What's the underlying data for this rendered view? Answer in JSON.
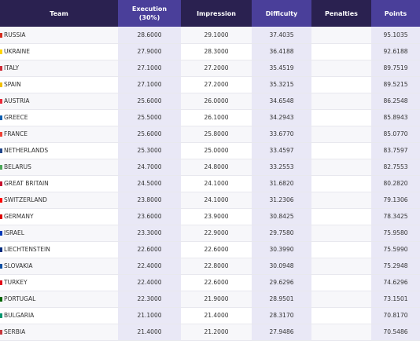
{
  "table": {
    "headers": {
      "team": "Team",
      "execution": "Execution\n(30%)",
      "impression": "Impression",
      "difficulty": "Difficulty",
      "penalties": "Penalties",
      "points": "Points"
    },
    "rows": [
      {
        "team": "RUSSIA",
        "flag_color": "#d52b1e",
        "execution": "28.6000",
        "impression": "29.1000",
        "difficulty": "37.4035",
        "penalties": "",
        "points": "95.1035"
      },
      {
        "team": "UKRAINE",
        "flag_color": "#ffd500",
        "execution": "27.9000",
        "impression": "28.3000",
        "difficulty": "36.4188",
        "penalties": "",
        "points": "92.6188"
      },
      {
        "team": "ITALY",
        "flag_color": "#ce2b37",
        "execution": "27.1000",
        "impression": "27.2000",
        "difficulty": "35.4519",
        "penalties": "",
        "points": "89.7519"
      },
      {
        "team": "SPAIN",
        "flag_color": "#f1bf00",
        "execution": "27.1000",
        "impression": "27.2000",
        "difficulty": "35.3215",
        "penalties": "",
        "points": "89.5215"
      },
      {
        "team": "AUSTRIA",
        "flag_color": "#ed2939",
        "execution": "25.6000",
        "impression": "26.0000",
        "difficulty": "34.6548",
        "penalties": "",
        "points": "86.2548"
      },
      {
        "team": "GREECE",
        "flag_color": "#0d5eaf",
        "execution": "25.5000",
        "impression": "26.1000",
        "difficulty": "34.2943",
        "penalties": "",
        "points": "85.8943"
      },
      {
        "team": "FRANCE",
        "flag_color": "#ef4135",
        "execution": "25.6000",
        "impression": "25.8000",
        "difficulty": "33.6770",
        "penalties": "",
        "points": "85.0770"
      },
      {
        "team": "NETHERLANDS",
        "flag_color": "#21468b",
        "execution": "25.3000",
        "impression": "25.0000",
        "difficulty": "33.4597",
        "penalties": "",
        "points": "83.7597"
      },
      {
        "team": "BELARUS",
        "flag_color": "#4aa657",
        "execution": "24.7000",
        "impression": "24.8000",
        "difficulty": "33.2553",
        "penalties": "",
        "points": "82.7553"
      },
      {
        "team": "GREAT BRITAIN",
        "flag_color": "#c8102e",
        "execution": "24.5000",
        "impression": "24.1000",
        "difficulty": "31.6820",
        "penalties": "",
        "points": "80.2820"
      },
      {
        "team": "SWITZERLAND",
        "flag_color": "#ff0000",
        "execution": "23.8000",
        "impression": "24.1000",
        "difficulty": "31.2306",
        "penalties": "",
        "points": "79.1306"
      },
      {
        "team": "GERMANY",
        "flag_color": "#dd0000",
        "execution": "23.6000",
        "impression": "23.9000",
        "difficulty": "30.8425",
        "penalties": "",
        "points": "78.3425"
      },
      {
        "team": "ISRAEL",
        "flag_color": "#0038b8",
        "execution": "23.3000",
        "impression": "22.9000",
        "difficulty": "29.7580",
        "penalties": "",
        "points": "75.9580"
      },
      {
        "team": "LIECHTENSTEIN",
        "flag_color": "#002b7f",
        "execution": "22.6000",
        "impression": "22.6000",
        "difficulty": "30.3990",
        "penalties": "",
        "points": "75.5990"
      },
      {
        "team": "SLOVAKIA",
        "flag_color": "#0b4ea2",
        "execution": "22.4000",
        "impression": "22.8000",
        "difficulty": "30.0948",
        "penalties": "",
        "points": "75.2948"
      },
      {
        "team": "TURKEY",
        "flag_color": "#e30a17",
        "execution": "22.4000",
        "impression": "22.6000",
        "difficulty": "29.6296",
        "penalties": "",
        "points": "74.6296"
      },
      {
        "team": "PORTUGAL",
        "flag_color": "#006600",
        "execution": "22.3000",
        "impression": "21.9000",
        "difficulty": "28.9501",
        "penalties": "",
        "points": "73.1501"
      },
      {
        "team": "BULGARIA",
        "flag_color": "#00966e",
        "execution": "21.1000",
        "impression": "21.4000",
        "difficulty": "28.3170",
        "penalties": "",
        "points": "70.8170"
      },
      {
        "team": "SERBIA",
        "flag_color": "#c6363c",
        "execution": "21.4000",
        "impression": "21.2000",
        "difficulty": "27.9486",
        "penalties": "",
        "points": "70.5486"
      }
    ]
  },
  "colors": {
    "header_bg": "#2a2150",
    "header_highlight_bg": "#4a3f9a",
    "highlight_cell_bg": "#e9e8f6"
  }
}
